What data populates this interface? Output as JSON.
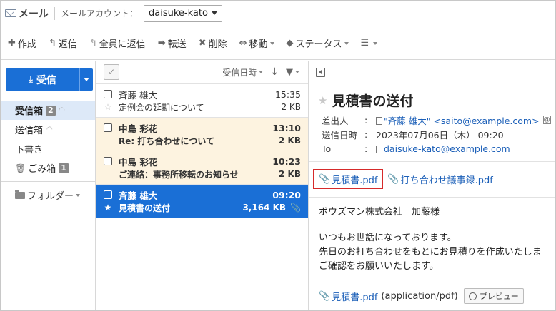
{
  "topbar": {
    "app_title": "メール",
    "account_label": "メールアカウント：",
    "account_value": "daisuke-kato"
  },
  "toolbar": {
    "create": "作成",
    "reply": "返信",
    "reply_all": "全員に返信",
    "forward": "転送",
    "delete": "削除",
    "move": "移動",
    "status": "ステータス"
  },
  "sidebar": {
    "receive_label": "受信",
    "folders": [
      {
        "label": "受信箱",
        "count": "2"
      },
      {
        "label": "送信箱"
      },
      {
        "label": "下書き"
      },
      {
        "label": "ごみ箱",
        "count": "1"
      }
    ],
    "folders_root": "フォルダー"
  },
  "list": {
    "sort_label": "受信日時",
    "messages": [
      {
        "from": "斉藤 雄大",
        "time": "15:35",
        "subject": "定例会の延期について",
        "size": "2 KB"
      },
      {
        "from": "中島 彩花",
        "time": "13:10",
        "subject": "Re: 打ち合わせについて",
        "size": "2 KB"
      },
      {
        "from": "中島 彩花",
        "time": "10:23",
        "subject": "ご連絡：事務所移転のお知らせ",
        "size": "2 KB"
      },
      {
        "from": "斉藤 雄大",
        "time": "09:20",
        "subject": "見積書の送付",
        "size": "3,164 KB"
      }
    ]
  },
  "detail": {
    "subject": "見積書の送付",
    "from_label": "差出人",
    "from_value": "\"斉藤 雄大\" <saito@example.com>",
    "date_label": "送信日時",
    "date_value": "2023年07月06日（木） 09:20",
    "to_label": "To",
    "to_value": "daisuke-kato@example.com",
    "attachments": [
      "見積書.pdf",
      "打ち合わせ議事録.pdf"
    ],
    "body": [
      "ボウズマン株式会社　加藤様",
      "いつもお世話になっております。",
      "先日のお打ち合わせをもとにお見積りを作成いたしま",
      "ご確認をお願いいたします。"
    ],
    "bottom_attachment": "見積書.pdf",
    "bottom_mime": "(application/pdf)",
    "preview_label": "プレビュー"
  },
  "colors": {
    "accent": "#1a6fd6",
    "unread_bg": "#fdf3e0",
    "highlight_border": "#d62a2a"
  }
}
